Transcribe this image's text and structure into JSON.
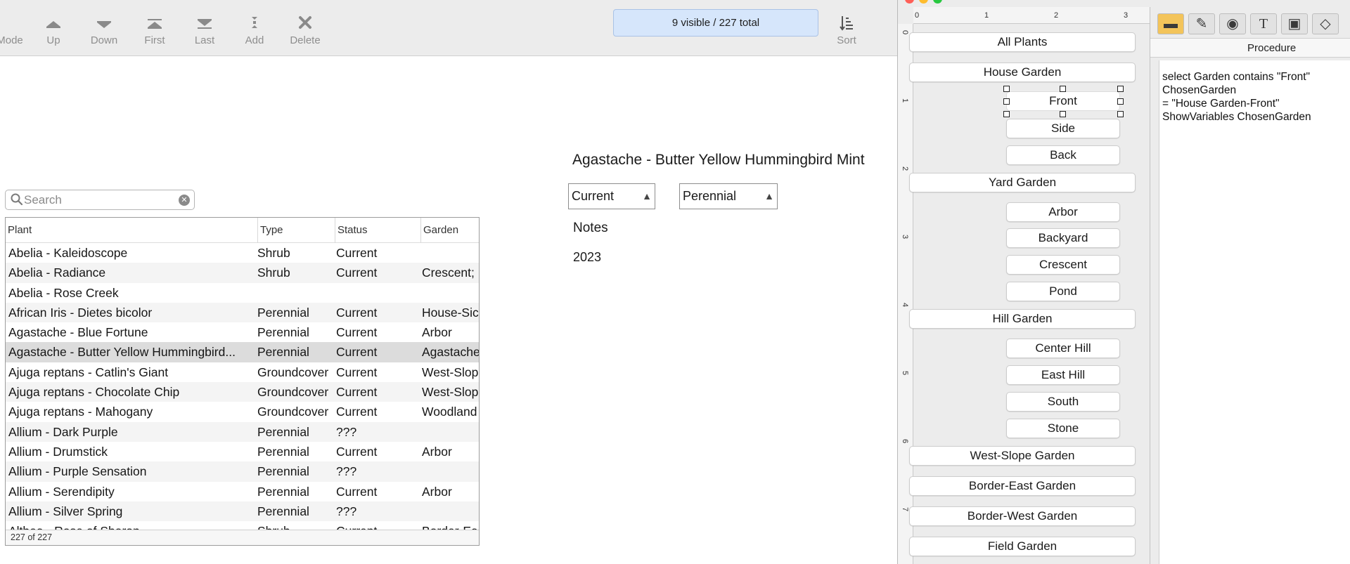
{
  "toolbar": {
    "buttons": [
      {
        "label": "Mode",
        "icon": "mode-icon"
      },
      {
        "label": "Up",
        "icon": "up-icon"
      },
      {
        "label": "Down",
        "icon": "down-icon"
      },
      {
        "label": "First",
        "icon": "first-icon"
      },
      {
        "label": "Last",
        "icon": "last-icon"
      },
      {
        "label": "Add",
        "icon": "add-icon"
      },
      {
        "label": "Delete",
        "icon": "delete-icon"
      },
      {
        "label": "Sort",
        "icon": "sort-icon"
      }
    ],
    "visible_count": "9 visible / 227 total"
  },
  "search": {
    "placeholder": "Search",
    "value": ""
  },
  "table": {
    "columns": [
      "Plant",
      "Type",
      "Status",
      "Garden"
    ],
    "rows": [
      [
        "Abelia - Kaleidoscope",
        "Shrub",
        "Current",
        ""
      ],
      [
        "Abelia - Radiance",
        "Shrub",
        "Current",
        "Crescent;"
      ],
      [
        "Abelia - Rose Creek",
        "",
        "",
        ""
      ],
      [
        "African Iris - Dietes bicolor",
        "Perennial",
        "Current",
        "House-Sic"
      ],
      [
        "Agastache - Blue Fortune",
        "Perennial",
        "Current",
        "Arbor"
      ],
      [
        "Agastache - Butter Yellow Hummingbird...",
        "Perennial",
        "Current",
        "Agastache"
      ],
      [
        "Ajuga reptans - Catlin's Giant",
        "Groundcover",
        "Current",
        "West-Slop"
      ],
      [
        "Ajuga reptans - Chocolate Chip",
        "Groundcover",
        "Current",
        "West-Slop"
      ],
      [
        "Ajuga reptans - Mahogany",
        "Groundcover",
        "Current",
        "Woodland"
      ],
      [
        "Allium - Dark Purple",
        "Perennial",
        "???",
        ""
      ],
      [
        "Allium - Drumstick",
        "Perennial",
        "Current",
        "Arbor"
      ],
      [
        "Allium - Purple Sensation",
        "Perennial",
        "???",
        ""
      ],
      [
        "Allium - Serendipity",
        "Perennial",
        "Current",
        "Arbor"
      ],
      [
        "Allium - Silver Spring",
        "Perennial",
        "???",
        ""
      ],
      [
        "Althea - Rose of Sharon",
        "Shrub",
        "Current",
        "Border-Ea"
      ]
    ],
    "selected_row": 5,
    "footer": "227 of 227"
  },
  "record": {
    "title": "Agastache - Butter Yellow Hummingbird Mint",
    "status_value": "Current",
    "type_value": "Perennial",
    "notes_label": "Notes",
    "notes_value": "2023"
  },
  "editor": {
    "ruler_h": [
      "0",
      "1",
      "2",
      "3"
    ],
    "ruler_v": [
      "0",
      "1",
      "2",
      "3",
      "4",
      "5",
      "6",
      "7"
    ],
    "buttons": {
      "all_plants": "All Plants",
      "house_garden": "House Garden",
      "front": "Front",
      "side": "Side",
      "back": "Back",
      "yard_garden": "Yard Garden",
      "arbor": "Arbor",
      "backyard": "Backyard",
      "crescent": "Crescent",
      "pond": "Pond",
      "hill_garden": "Hill Garden",
      "center_hill": "Center Hill",
      "east_hill": "East Hill",
      "south": "South",
      "stone": "Stone",
      "west_slope": "West-Slope Garden",
      "border_east": "Border-East Garden",
      "border_west": "Border-West Garden",
      "field": "Field Garden"
    },
    "procedure_tab": "Procedure",
    "procedure_lines": [
      "select Garden contains \"Front\"",
      "ChosenGarden",
      "= \"House Garden-Front\"",
      "ShowVariables ChosenGarden"
    ],
    "tools": [
      "button-tool-icon",
      "pencil-icon",
      "shapes-icon",
      "text-icon",
      "image-icon",
      "diamond-icon"
    ]
  },
  "colors": {
    "counter_bg": "#d6e6fb",
    "selected_row": "#dcdcdc",
    "close": "#ff5f57",
    "minimize": "#febc2e",
    "zoom": "#28c840"
  }
}
